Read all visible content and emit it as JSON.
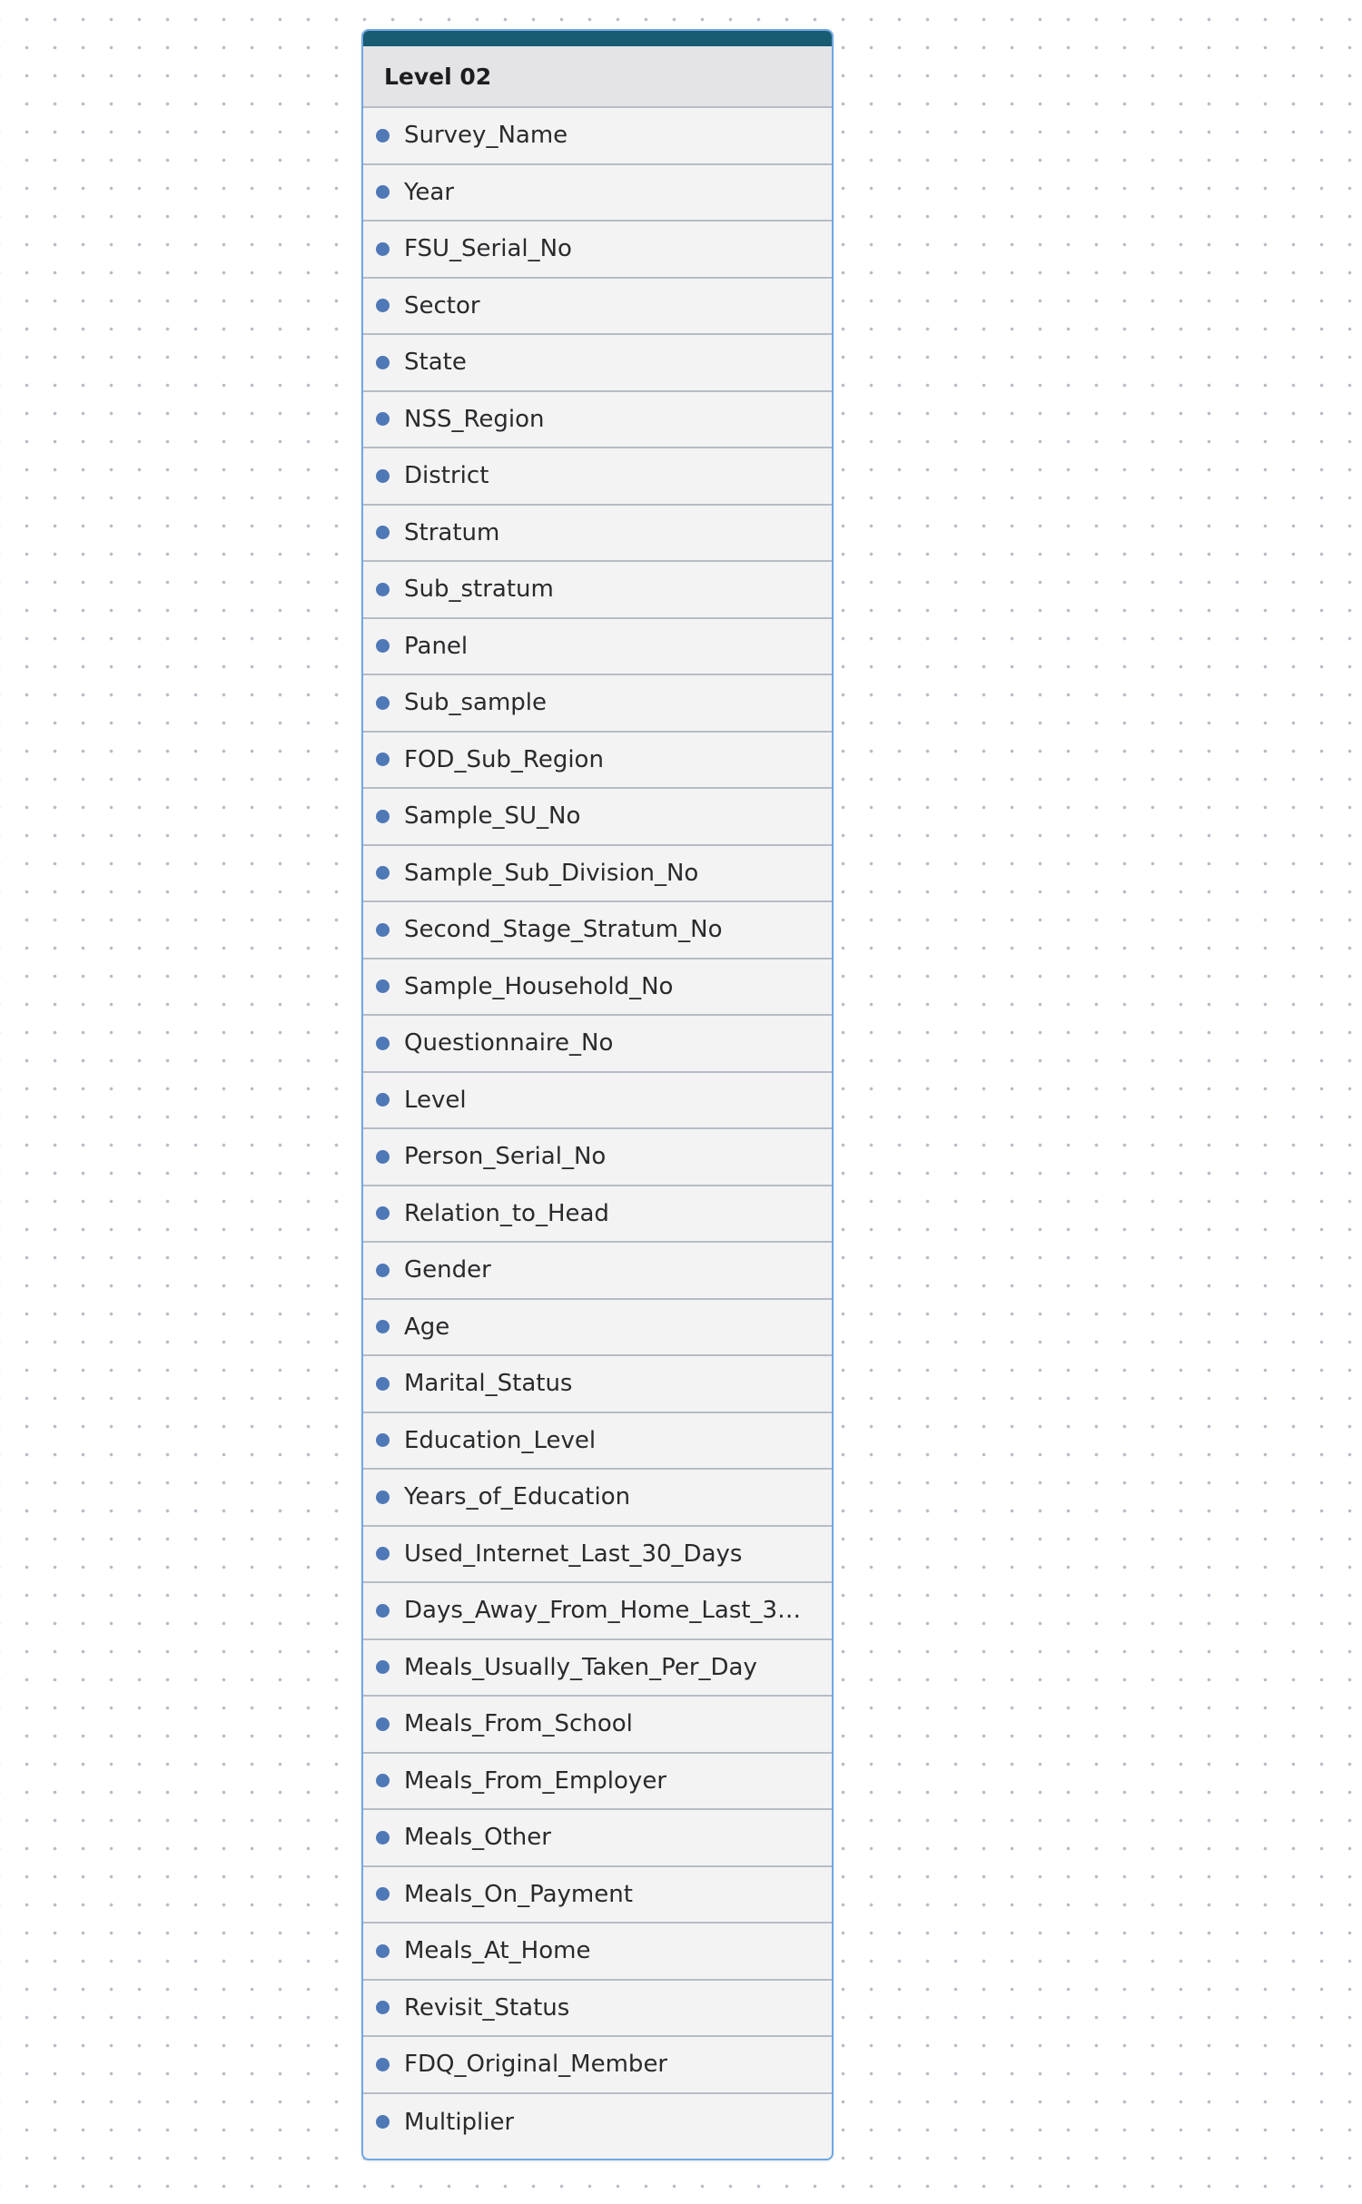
{
  "table": {
    "title": "Level 02",
    "colors": {
      "accent": "#185c73",
      "border": "#6fa8e6",
      "dot": "#4f78b6"
    },
    "fields": [
      "Survey_Name",
      "Year",
      "FSU_Serial_No",
      "Sector",
      "State",
      "NSS_Region",
      "District",
      "Stratum",
      "Sub_stratum",
      "Panel",
      "Sub_sample",
      "FOD_Sub_Region",
      "Sample_SU_No",
      "Sample_Sub_Division_No",
      "Second_Stage_Stratum_No",
      "Sample_Household_No",
      "Questionnaire_No",
      "Level",
      "Person_Serial_No",
      "Relation_to_Head",
      "Gender",
      "Age",
      "Marital_Status",
      "Education_Level",
      "Years_of_Education",
      "Used_Internet_Last_30_Days",
      "Days_Away_From_Home_Last_30_D...",
      "Meals_Usually_Taken_Per_Day",
      "Meals_From_School",
      "Meals_From_Employer",
      "Meals_Other",
      "Meals_On_Payment",
      "Meals_At_Home",
      "Revisit_Status",
      "FDQ_Original_Member",
      "Multiplier"
    ]
  }
}
